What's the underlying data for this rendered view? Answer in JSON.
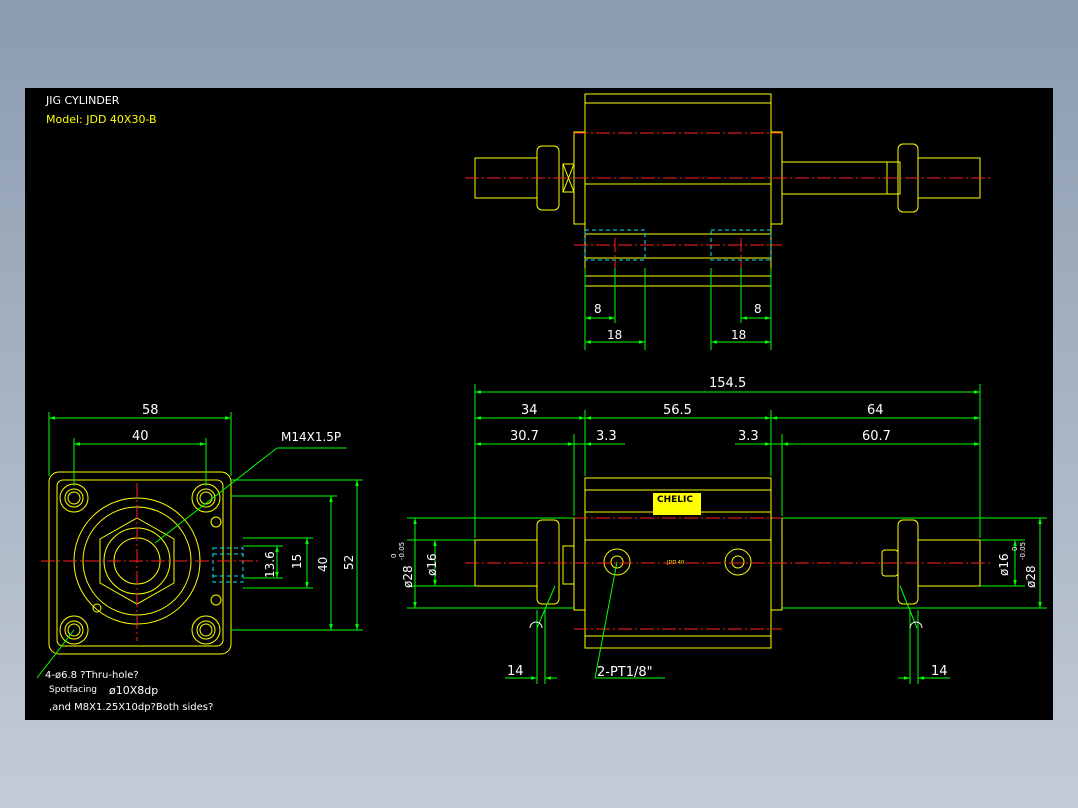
{
  "title": {
    "line1": "JIG CYLINDER",
    "line2": "Model: JDD 40X30-B"
  },
  "colors": {
    "background_outer": "#8b9bb0",
    "canvas": "#000000",
    "outline": "#ffff00",
    "dimension": "#00ff00",
    "centerline": "#ff2020",
    "hidden": "#00e5ff",
    "white_text": "#ffffff"
  },
  "top_view": {
    "dims": {
      "a": "8",
      "b": "18",
      "c": "8",
      "d": "18"
    }
  },
  "front_view": {
    "dims": {
      "overall": "154.5",
      "left_len": "34",
      "body_len": "56.5",
      "right_len": "64",
      "left_rod": "30.7",
      "gap_l": "3.3",
      "gap_r": "3.3",
      "right_rod": "60.7",
      "nut_l": "14",
      "nut_r": "14"
    },
    "dia_left_16": "ø16",
    "dia_left_28": "ø28",
    "tol_left_top": "0",
    "tol_left_bot": "-0.05",
    "dia_right_16": "ø16",
    "dia_right_28": "ø28",
    "tol_right_top": "0",
    "tol_right_bot": "-0.05",
    "port_note": "2-PT1/8\"",
    "label_brand": "CHELIC",
    "label_small": "JDD 40"
  },
  "side_view": {
    "dims": {
      "w58": "58",
      "w40": "40",
      "h13": "13.6",
      "h15": "15",
      "h40": "40",
      "h52": "52"
    },
    "thread": "M14X1.5P",
    "notes": {
      "line1": "4-ø6.8 ?Thru-hole?",
      "line2a": "Spotfacing",
      "line2b": "ø10X8dp",
      "line3": ",and M8X1.25X10dp?Both sides?"
    }
  }
}
